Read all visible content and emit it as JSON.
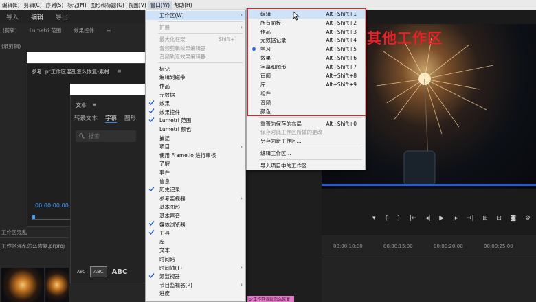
{
  "menubar": {
    "items": [
      "编辑(E)",
      "剪辑(C)",
      "序列(S)",
      "标记(M)",
      "图形和标题(G)",
      "视图(V)",
      "窗口(W)",
      "帮助(H)"
    ],
    "active_index": 6
  },
  "workspace_tabs": [
    "导入",
    "编辑",
    "导出"
  ],
  "workspace_active": 1,
  "left_panel": {
    "tab_left": "(剪辑)",
    "tab_lumetri": "Lumetri 范围",
    "tab_effects": "效果控件",
    "sub_tab": "(录剪辑)",
    "source_title": "参考: pr工作区混乱怎么恢复-素材",
    "timecode": "00:00:00:00",
    "project_tab": "工作区混乱",
    "project_name": "工作区混乱怎么恢复.prproj"
  },
  "text_panel": {
    "title": "文本",
    "tabs": [
      "转录文本",
      "字幕",
      "图形"
    ],
    "active_tab": 1,
    "search_placeholder": "搜索",
    "abc_small": "ABC",
    "abc_box": "ABC",
    "abc_big": "ABC"
  },
  "window_menu": {
    "items": [
      {
        "label": "工作区(W)",
        "arrow": true,
        "highlight": true
      },
      {
        "sep": true
      },
      {
        "label": "扩展",
        "arrow": true,
        "disabled": true
      },
      {
        "sep": true
      },
      {
        "label": "最大化框架",
        "shortcut": "Shift+`",
        "disabled": true
      },
      {
        "label": "音频剪辑效果编辑器",
        "disabled": true
      },
      {
        "label": "音频轨道效果编辑器",
        "disabled": true
      },
      {
        "sep": true
      },
      {
        "label": "标记"
      },
      {
        "label": "编辑到磁带"
      },
      {
        "label": "作品"
      },
      {
        "label": "元数据"
      },
      {
        "label": "效果",
        "checked": true
      },
      {
        "label": "效果控件",
        "checked": true
      },
      {
        "label": "Lumetri 范围",
        "checked": true
      },
      {
        "label": "Lumetri 颜色"
      },
      {
        "label": "捕捉"
      },
      {
        "label": "项目",
        "arrow": true
      },
      {
        "label": "使用 Frame.io 进行审核"
      },
      {
        "label": "了解"
      },
      {
        "label": "事件"
      },
      {
        "label": "信息"
      },
      {
        "label": "历史记录",
        "checked": true
      },
      {
        "label": "参考监视器",
        "arrow": true
      },
      {
        "label": "基本图形"
      },
      {
        "label": "基本声音"
      },
      {
        "label": "媒体浏览器",
        "checked": true
      },
      {
        "label": "工具",
        "checked": true
      },
      {
        "label": "库"
      },
      {
        "label": "文本"
      },
      {
        "label": "时间码"
      },
      {
        "label": "时间轴(T)",
        "arrow": true
      },
      {
        "label": "源监视器",
        "checked": true
      },
      {
        "label": "节目监视器(P)",
        "arrow": true
      },
      {
        "label": "进度"
      }
    ]
  },
  "workspace_submenu": {
    "items": [
      {
        "label": "编辑",
        "shortcut": "Alt+Shift+1",
        "highlight": true
      },
      {
        "label": "所有面板",
        "shortcut": "Alt+Shift+2"
      },
      {
        "label": "作品",
        "shortcut": "Alt+Shift+3"
      },
      {
        "label": "元数据记录",
        "shortcut": "Alt+Shift+4"
      },
      {
        "label": "学习",
        "shortcut": "Alt+Shift+5",
        "bullet": true
      },
      {
        "label": "效果",
        "shortcut": "Alt+Shift+6"
      },
      {
        "label": "字幕和图形",
        "shortcut": "Alt+Shift+7"
      },
      {
        "label": "审阅",
        "shortcut": "Alt+Shift+8"
      },
      {
        "label": "库",
        "shortcut": "Alt+Shift+9"
      },
      {
        "label": "组件"
      },
      {
        "label": "音频"
      },
      {
        "label": "颜色"
      },
      {
        "sep": true
      },
      {
        "label": "重置为保存的布局",
        "shortcut": "Alt+Shift+0"
      },
      {
        "label": "保存对此工作区所做的更改",
        "disabled": true
      },
      {
        "label": "另存为新工作区..."
      },
      {
        "sep": true
      },
      {
        "label": "编辑工作区..."
      },
      {
        "sep": true
      },
      {
        "label": "导入项目中的工作区"
      }
    ]
  },
  "annotation": {
    "text": "其他工作区",
    "color": "#e8202a"
  },
  "timeline": {
    "ruler": [
      "00:00:10:00",
      "00:00:15:00",
      "00:00:20:00",
      "00:00:25:00"
    ],
    "clip_label": "pr工作区混乱怎么恢复"
  },
  "colors": {
    "accent": "#2d8ceb",
    "highlight_box": "#e0232c",
    "menu_bg": "#f2f2f2"
  }
}
